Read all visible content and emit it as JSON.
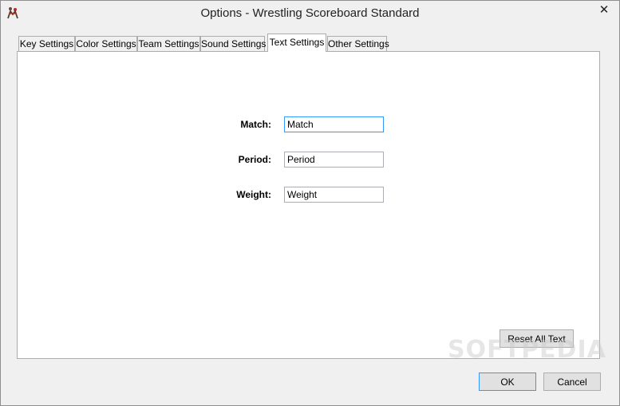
{
  "window": {
    "title": "Options - Wrestling Scoreboard Standard",
    "close_glyph": "✕",
    "icon": "wrestler-app-icon"
  },
  "tabs": [
    {
      "label": "Key Settings",
      "active": false
    },
    {
      "label": "Color Settings",
      "active": false
    },
    {
      "label": "Team Settings",
      "active": false
    },
    {
      "label": "Sound Settings",
      "active": false
    },
    {
      "label": "Text Settings",
      "active": true
    },
    {
      "label": "Other Settings",
      "active": false
    }
  ],
  "text_settings": {
    "match": {
      "label": "Match:",
      "value": "Match"
    },
    "period": {
      "label": "Period:",
      "value": "Period"
    },
    "weight": {
      "label": "Weight:",
      "value": "Weight"
    },
    "reset_label": "Reset All Text"
  },
  "footer": {
    "ok_label": "OK",
    "cancel_label": "Cancel"
  },
  "watermark": "SOFTPEDIA"
}
